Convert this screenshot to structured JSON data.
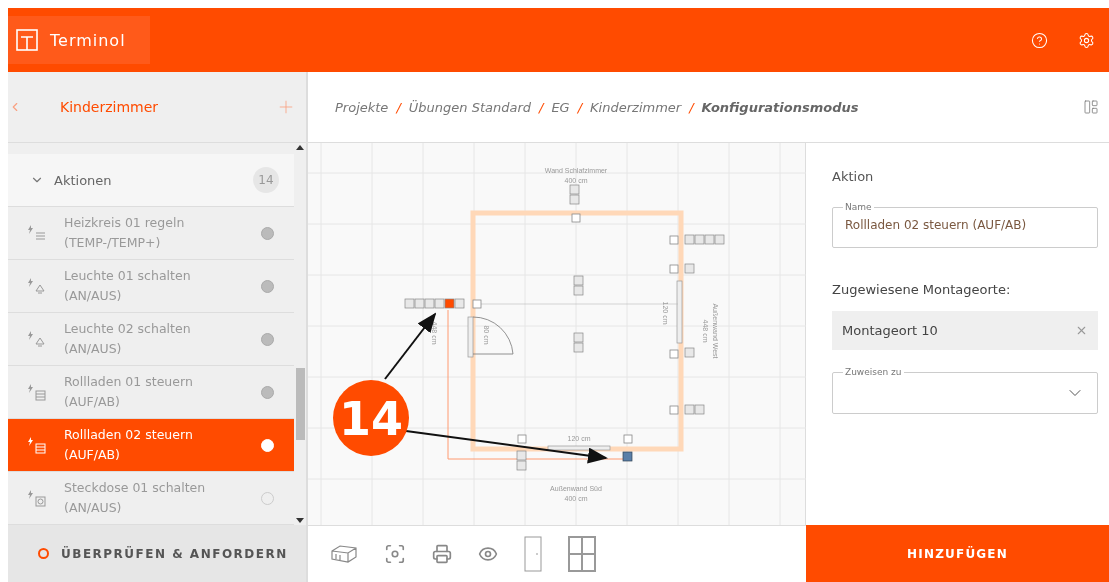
{
  "header": {
    "logo": "Terminol"
  },
  "sidebar": {
    "title": "Kinderzimmer",
    "section": {
      "label": "Aktionen",
      "count": "14",
      "expanded": true
    },
    "items": [
      {
        "kind": "heating",
        "title": "Heizkreis 01 regeln",
        "subtitle": "(TEMP-/TEMP+)",
        "selected": false,
        "assigned": true
      },
      {
        "kind": "light",
        "title": "Leuchte 01 schalten",
        "subtitle": "(AN/AUS)",
        "selected": false,
        "assigned": true
      },
      {
        "kind": "light",
        "title": "Leuchte 02 schalten",
        "subtitle": "(AN/AUS)",
        "selected": false,
        "assigned": true
      },
      {
        "kind": "shutter",
        "title": "Rollladen 01 steuern",
        "subtitle": "(AUF/AB)",
        "selected": false,
        "assigned": true
      },
      {
        "kind": "shutter",
        "title": "Rollladen 02 steuern",
        "subtitle": "(AUF/AB)",
        "selected": true,
        "assigned": true
      },
      {
        "kind": "socket",
        "title": "Steckdose 01 schalten",
        "subtitle": "(AN/AUS)",
        "selected": false,
        "assigned": false
      }
    ],
    "footer_button": "ÜBERPRÜFEN & ANFORDERN"
  },
  "breadcrumb": {
    "separator": "/",
    "items": [
      "Projekte",
      "Übungen Standard",
      "EG",
      "Kinderzimmer",
      "Konfigurationsmodus"
    ]
  },
  "plan": {
    "top_wall": {
      "name": "Wand Schlafzimmer",
      "length": "400 cm"
    },
    "bottom_wall": {
      "name": "Außenwand Süd",
      "length": "400 cm"
    },
    "right_wall": {
      "name": "Außenwand West",
      "length": "448 cm"
    },
    "left_wall_length": "448 cm",
    "door_width": "80 cm",
    "right_window_width": "120 cm",
    "bottom_window_width": "120 cm",
    "callout": "14"
  },
  "panel": {
    "title": "Aktion",
    "name_field": {
      "label": "Name",
      "value": "Rollladen 02 steuern (AUF/AB)"
    },
    "assigned_label": "Zugewiesene Montageorte:",
    "assigned": [
      {
        "label": "Montageort 10"
      }
    ],
    "assign_field": {
      "label": "Zuweisen zu"
    },
    "button": "HINZUFÜGEN"
  }
}
